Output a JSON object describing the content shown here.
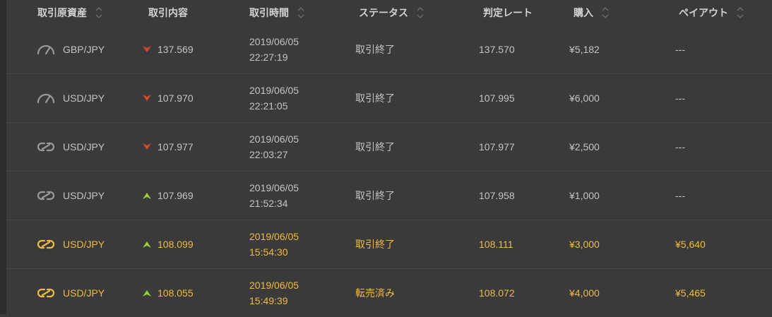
{
  "header": {
    "asset": "取引原資産",
    "content": "取引内容",
    "time": "取引時間",
    "status": "ステータス",
    "rate": "判定レート",
    "purchase": "購入",
    "payout": "ペイアウト"
  },
  "colors": {
    "down": "#d9482b",
    "up": "#9cd13a",
    "active": "#f1bb3d",
    "inactive_icon": "#9a9a9a"
  },
  "rows": [
    {
      "icon": "speedometer-icon",
      "asset": "GBP/JPY",
      "direction": "down",
      "entry": "137.569",
      "date": "2019/06/05",
      "clock": "22:27:19",
      "status": "取引終了",
      "rate": "137.570",
      "purchase": "¥5,182",
      "payout": "---",
      "active": false
    },
    {
      "icon": "speedometer-icon",
      "asset": "USD/JPY",
      "direction": "down",
      "entry": "107.970",
      "date": "2019/06/05",
      "clock": "22:21:05",
      "status": "取引終了",
      "rate": "107.995",
      "purchase": "¥6,000",
      "payout": "---",
      "active": false
    },
    {
      "icon": "chain-link-icon",
      "asset": "USD/JPY",
      "direction": "down",
      "entry": "107.977",
      "date": "2019/06/05",
      "clock": "22:03:27",
      "status": "取引終了",
      "rate": "107.977",
      "purchase": "¥2,500",
      "payout": "---",
      "active": false
    },
    {
      "icon": "chain-link-icon",
      "asset": "USD/JPY",
      "direction": "up",
      "entry": "107.969",
      "date": "2019/06/05",
      "clock": "21:52:34",
      "status": "取引終了",
      "rate": "107.958",
      "purchase": "¥1,000",
      "payout": "---",
      "active": false
    },
    {
      "icon": "chain-link-icon",
      "asset": "USD/JPY",
      "direction": "up",
      "entry": "108.099",
      "date": "2019/06/05",
      "clock": "15:54:30",
      "status": "取引終了",
      "rate": "108.111",
      "purchase": "¥3,000",
      "payout": "¥5,640",
      "active": true
    },
    {
      "icon": "chain-link-icon",
      "asset": "USD/JPY",
      "direction": "up",
      "entry": "108.055",
      "date": "2019/06/05",
      "clock": "15:49:39",
      "status": "転売済み",
      "rate": "108.072",
      "purchase": "¥4,000",
      "payout": "¥5,465",
      "active": true
    }
  ]
}
